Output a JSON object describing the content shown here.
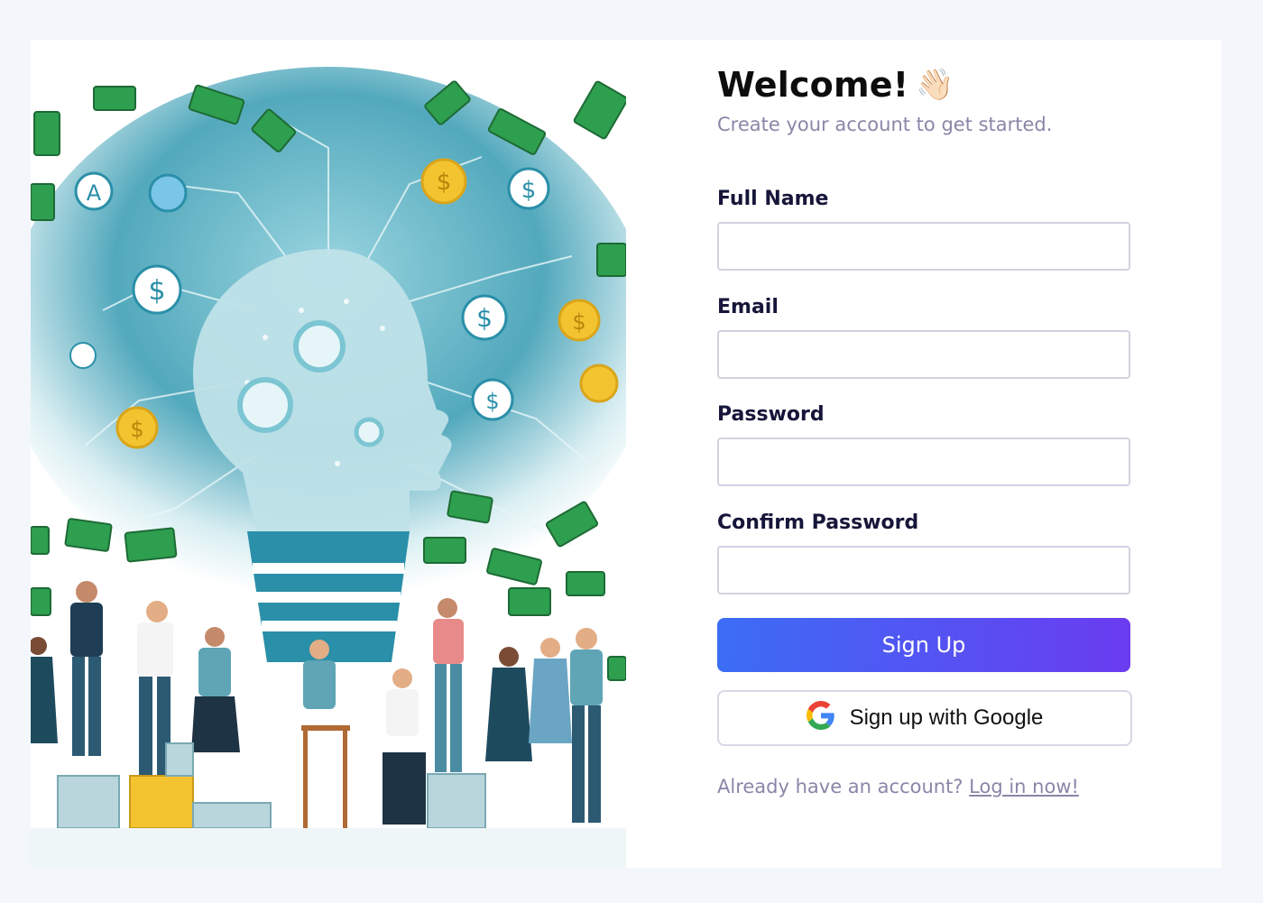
{
  "form": {
    "title": "Welcome!",
    "wave_emoji": "👋🏻",
    "subtitle": "Create your account to get started.",
    "fields": [
      {
        "label": "Full Name",
        "value": "",
        "placeholder": ""
      },
      {
        "label": "Email",
        "value": "",
        "placeholder": ""
      },
      {
        "label": "Password",
        "value": "",
        "placeholder": ""
      },
      {
        "label": "Confirm Password",
        "value": "",
        "placeholder": ""
      }
    ],
    "signup_label": "Sign Up",
    "google_label": "Sign up with Google",
    "footer_prompt": "Already have an account?",
    "footer_link": "Log in now!"
  },
  "colors": {
    "primary_gradient_start": "#3c6df5",
    "primary_gradient_end": "#6a3cf0",
    "money_green": "#2e9e4f",
    "coin_gold": "#f4c430",
    "teal": "#2a8fa8"
  },
  "icons": {
    "google": "google-g-icon",
    "wave": "waving-hand-icon"
  }
}
